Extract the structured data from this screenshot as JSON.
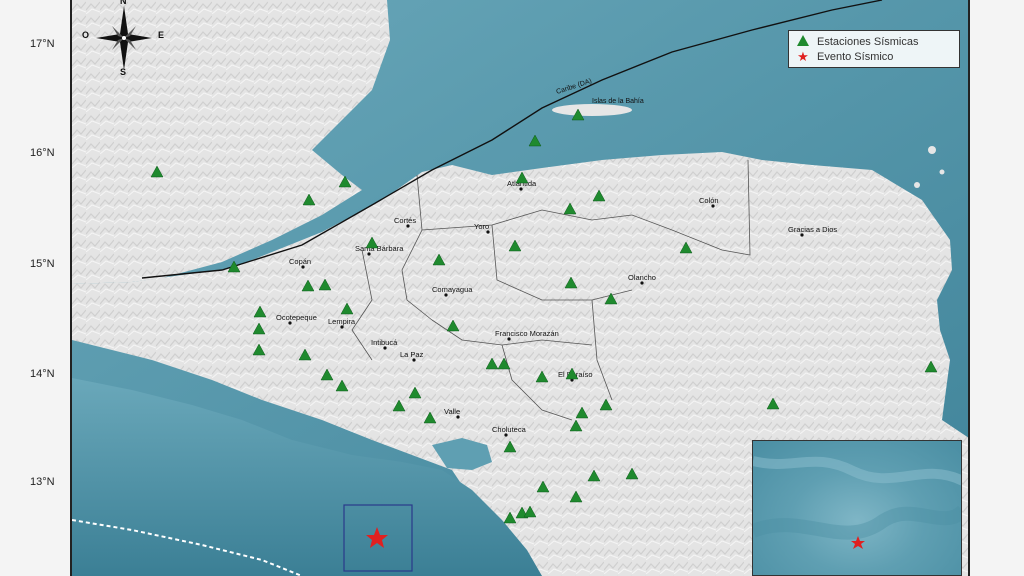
{
  "latitudes": [
    "17°N",
    "16°N",
    "15°N",
    "14°N",
    "13°N"
  ],
  "compass": {
    "north": "N",
    "west": "O",
    "east": "E",
    "south": "S"
  },
  "legend": {
    "stations_label": "Estaciones Sísmicas",
    "event_label": "Evento Sísmico",
    "station_color": "#1f8a2e",
    "event_color": "#e02020"
  },
  "features": {
    "fault_label": "Caribe (DA)",
    "islands_label": "Islas de la Bahía"
  },
  "cities": [
    {
      "name": "Atlántida"
    },
    {
      "name": "Colón"
    },
    {
      "name": "Cortés"
    },
    {
      "name": "Yoro"
    },
    {
      "name": "Gracias a Dios"
    },
    {
      "name": "Santa Bárbara"
    },
    {
      "name": "Copán"
    },
    {
      "name": "Olancho"
    },
    {
      "name": "Comayagua"
    },
    {
      "name": "Ocotepeque"
    },
    {
      "name": "Lempira"
    },
    {
      "name": "Francisco Morazán"
    },
    {
      "name": "Intibucá"
    },
    {
      "name": "La Paz"
    },
    {
      "name": "El Paraíso"
    },
    {
      "name": "Valle"
    },
    {
      "name": "Choluteca"
    }
  ],
  "colors": {
    "sea": "#5f9fb2",
    "deep_sea": "#3f8399",
    "land": "#e6e6e6",
    "fault": "#111111"
  }
}
